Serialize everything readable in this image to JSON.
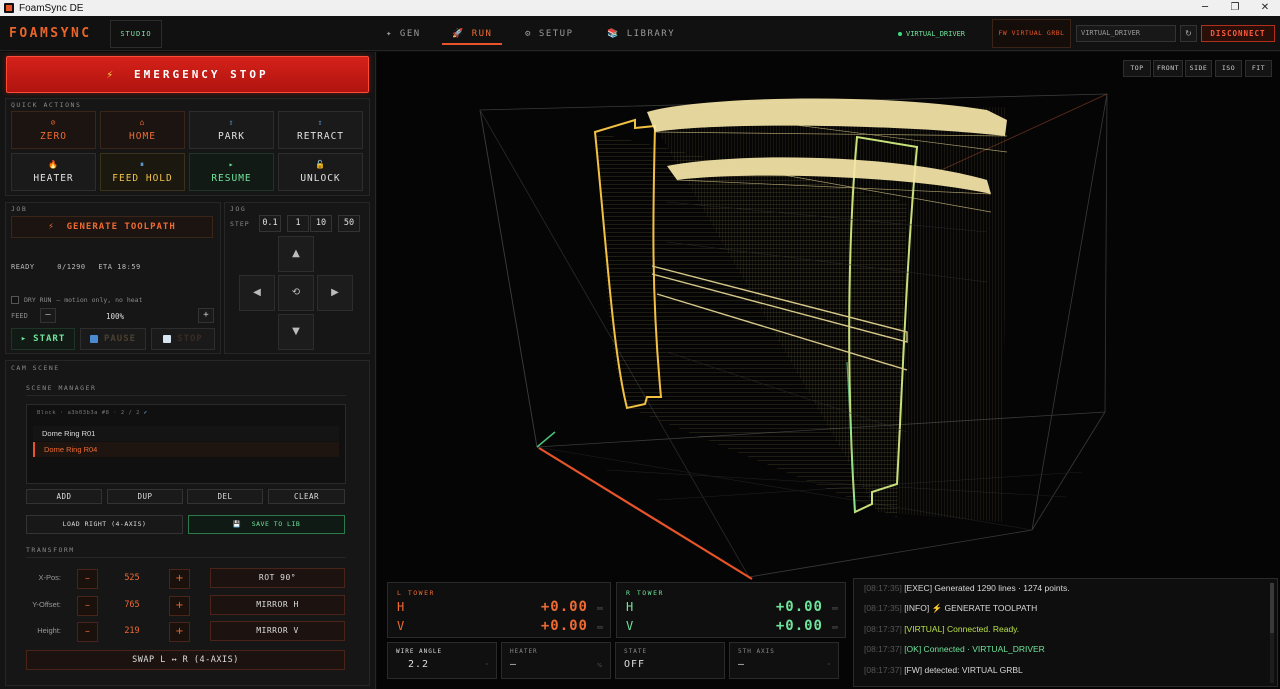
{
  "window": {
    "title": "FoamSync DE",
    "minimize": "─",
    "maximize": "❐",
    "close": "✕"
  },
  "header": {
    "brand": "FOAMSYNC",
    "studio_label": "STUDIO",
    "tabs": [
      {
        "label": "GEN",
        "icon": "✦"
      },
      {
        "label": "RUN",
        "icon": "🚀"
      },
      {
        "label": "SETUP",
        "icon": "⚙"
      },
      {
        "label": "LIBRARY",
        "icon": "📚"
      }
    ],
    "connection_status": "VIRTUAL_DRIVER",
    "firmware_badge": "FW VIRTUAL GRBL",
    "port_value": "VIRTUAL_DRIVER",
    "refresh_icon": "↻",
    "disconnect_label": "DISCONNECT"
  },
  "emergency_stop": {
    "label": "EMERGENCY STOP",
    "icon": "⚡"
  },
  "quick_actions": {
    "title": "QUICK ACTIONS",
    "buttons": [
      {
        "label": "ZERO",
        "icon": "⊘"
      },
      {
        "label": "HOME",
        "icon": "⌂"
      },
      {
        "label": "PARK",
        "icon": "⇧"
      },
      {
        "label": "RETRACT",
        "icon": "⇧"
      },
      {
        "label": "HEATER",
        "icon": "🔥"
      },
      {
        "label": "FEED HOLD",
        "icon": "⏸"
      },
      {
        "label": "RESUME",
        "icon": "▸"
      },
      {
        "label": "UNLOCK",
        "icon": "🔓"
      }
    ]
  },
  "job": {
    "title": "JOB",
    "generate_label": "GENERATE TOOLPATH",
    "generate_icon": "⚡",
    "state": "READY",
    "progress": "0/1290",
    "eta": "ETA 18:59",
    "dry_run_label": "DRY RUN",
    "dry_run_hint": "—  motion only, no heat",
    "feed_label": "FEED",
    "feed_minus": "–",
    "feed_value": "100%",
    "feed_plus": "+",
    "start_label": "START",
    "start_icon": "▸",
    "pause_label": "PAUSE",
    "stop_label": "STOP"
  },
  "jog": {
    "title": "JOG",
    "step_label": "STEP",
    "steps": [
      "0.1",
      "1",
      "10",
      "50"
    ],
    "up": "▲",
    "down": "▼",
    "left": "◀",
    "right": "▶",
    "center": "⟲"
  },
  "cam_scene": {
    "title": "CAM SCENE",
    "manager_title": "SCENE MANAGER",
    "header_text": "Block · a3b03b3a #8 · 2 / 2",
    "header_check": "✓",
    "items": [
      "Dome Ring R01",
      "Dome Ring R04"
    ],
    "buttons": [
      "ADD",
      "DUP",
      "DEL",
      "CLEAR"
    ],
    "load_right_label": "LOAD RIGHT (4-AXIS)",
    "save_lib_label": "SAVE TO LIB",
    "save_lib_icon": "💾"
  },
  "transform": {
    "title": "TRANSFORM",
    "fields": [
      {
        "label": "X-Pos:",
        "value": "525"
      },
      {
        "label": "Y-Offset:",
        "value": "765"
      },
      {
        "label": "Height:",
        "value": "219"
      }
    ],
    "minus": "–",
    "plus": "+",
    "actions": [
      "ROT 90°",
      "MIRROR H",
      "MIRROR V"
    ],
    "swap_label": "SWAP L ↔ R  (4-AXIS)"
  },
  "viewport": {
    "view_buttons": [
      "TOP",
      "FRONT",
      "SIDE",
      "ISO",
      "FIT"
    ]
  },
  "towers": {
    "left": {
      "title": "L TOWER",
      "h_axis": "H",
      "v_axis": "V",
      "h_value": "+0.00",
      "v_value": "+0.00",
      "unit": "mm"
    },
    "right": {
      "title": "R TOWER",
      "h_axis": "H",
      "v_axis": "V",
      "h_value": "+0.00",
      "v_value": "+0.00",
      "unit": "mm"
    }
  },
  "stats": [
    {
      "label": "WIRE ANGLE",
      "value": "2.2",
      "unit": "°"
    },
    {
      "label": "HEATER",
      "value": "—",
      "unit": "%"
    },
    {
      "label": "STATE",
      "value": "OFF",
      "unit": ""
    },
    {
      "label": "5TH AXIS",
      "value": "—",
      "unit": "°"
    }
  ],
  "log": [
    {
      "time": "[08:17:35]",
      "text": "[EXEC] Generated 1290 lines · 1274 points."
    },
    {
      "time": "[08:17:35]",
      "text": "[INFO] ⚡ GENERATE TOOLPATH"
    },
    {
      "time": "[08:17:37]",
      "text": "[VIRTUAL] Connected. Ready."
    },
    {
      "time": "[08:17:37]",
      "text": "[OK] Connected · VIRTUAL_DRIVER"
    },
    {
      "time": "[08:17:37]",
      "text": "[FW] detected: VIRTUAL GRBL"
    }
  ],
  "colors": {
    "accent": "#e8542a",
    "green": "#3ddc84",
    "yellow": "#f0c24a",
    "estop": "#c81a14",
    "log_exec": "#d8d8d8",
    "log_virtual": "#b9e04a",
    "log_ok": "#6fe39a"
  }
}
